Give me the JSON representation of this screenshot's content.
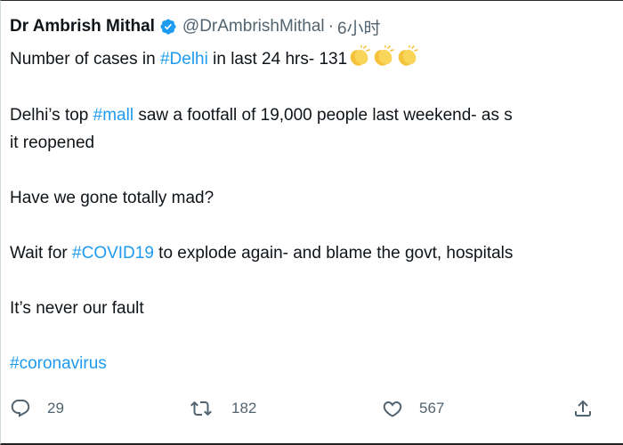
{
  "tweet": {
    "author_name": "Dr Ambrish Mithal",
    "handle": "@DrAmbrishMithal",
    "separator": "·",
    "time": "6小时",
    "lines": {
      "l1_prefix": "Number of cases in ",
      "l1_tag": "#Delhi",
      "l1_suffix": " in last 24 hrs- 131",
      "l2_prefix": "Delhi’s top ",
      "l2_tag": "#mall",
      "l2_suffix": " saw a footfall of 19,000 people last weekend- as s",
      "l3": "it reopened",
      "l4": "Have we gone totally mad?",
      "l5_prefix": "Wait for ",
      "l5_tag": "#COVID19",
      "l5_suffix": " to explode again- and blame the govt, hospitals",
      "l6": "It’s never our fault",
      "l7_tag": "#coronavirus"
    }
  },
  "actions": {
    "replies": "29",
    "retweets": "182",
    "likes": "567"
  },
  "icons": {
    "verified": "verified-badge-icon",
    "clap": "clapping-hands-icon",
    "reply": "reply-icon",
    "retweet": "retweet-icon",
    "like": "heart-icon",
    "share": "share-icon"
  },
  "colors": {
    "hashtag": "#1d9bf0",
    "muted": "#536471",
    "text": "#0f1419",
    "clap": "#f5c33b"
  }
}
